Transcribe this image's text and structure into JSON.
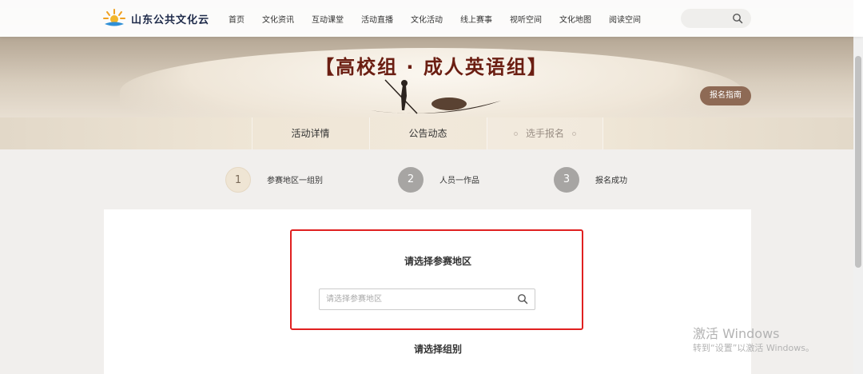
{
  "header": {
    "logo_text": "山东公共文化云",
    "nav": [
      "首页",
      "文化资讯",
      "互动课堂",
      "活动直播",
      "文化活动",
      "线上赛事",
      "视听空间",
      "文化地图",
      "阅读空间"
    ],
    "search_placeholder": ""
  },
  "banner": {
    "title": "【高校组 · 成人英语组】",
    "guide_button": "报名指南"
  },
  "subtabs": {
    "items": [
      "活动详情",
      "公告动态",
      "选手报名"
    ],
    "active": "选手报名"
  },
  "steps": [
    {
      "number": "1",
      "label": "参赛地区一组别",
      "state": "active"
    },
    {
      "number": "2",
      "label": "人员一作品",
      "state": "inactive"
    },
    {
      "number": "3",
      "label": "报名成功",
      "state": "inactive"
    }
  ],
  "form": {
    "region_title": "请选择参赛地区",
    "region_placeholder": "请选择参赛地区",
    "region_value": "",
    "group_title": "请选择组别"
  },
  "watermark": {
    "line1": "激活 Windows",
    "line2": "转到“设置”以激活 Windows。"
  },
  "colors": {
    "brand_title": "#6b1e12",
    "highlight_border": "#e02020",
    "guide_button_bg": "#8e6a55"
  }
}
